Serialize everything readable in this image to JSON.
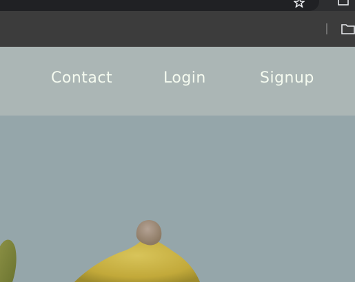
{
  "browser": {
    "icons": [
      "bookmark-star-icon",
      "extensions-icon",
      "bookmarks-folder-icon"
    ]
  },
  "nav": {
    "links": [
      "Contact",
      "Login",
      "Signup"
    ],
    "background": "#abb6b5",
    "text_color": "#f5fbf0"
  },
  "hero": {
    "background": "#95a6aa"
  }
}
